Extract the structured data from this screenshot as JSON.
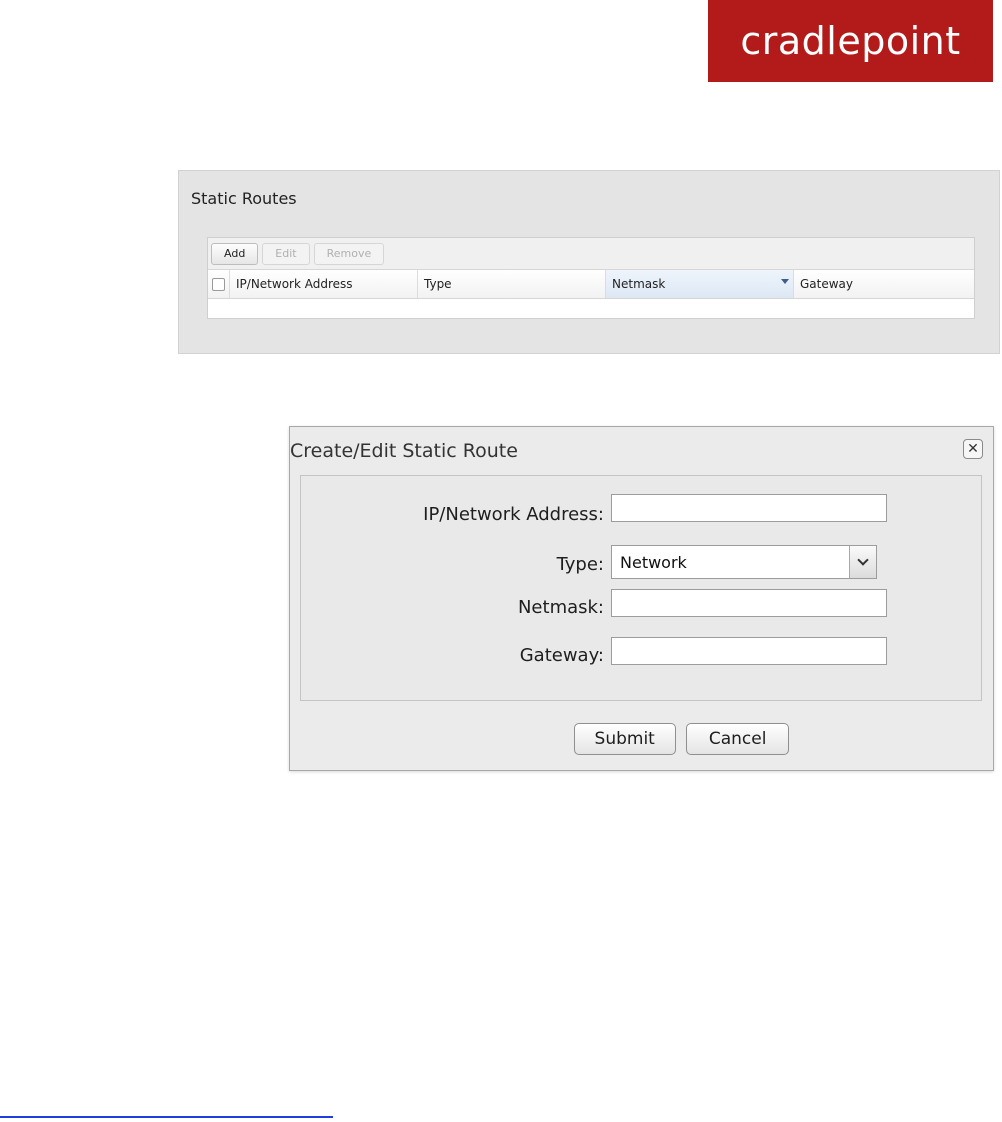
{
  "logo": {
    "text": "cradlepoint",
    "color": "#b31b1b"
  },
  "static_routes": {
    "title": "Static Routes",
    "toolbar": {
      "add": "Add",
      "edit": "Edit",
      "remove": "Remove"
    },
    "columns": [
      "IP/Network Address",
      "Type",
      "Netmask",
      "Gateway"
    ],
    "sorted_column": "Netmask",
    "rows": []
  },
  "dialog": {
    "title": "Create/Edit Static Route",
    "close_icon": "close-icon",
    "fields": {
      "ip": {
        "label": "IP/Network Address:",
        "value": ""
      },
      "type": {
        "label": "Type:",
        "value": "Network"
      },
      "netmask": {
        "label": "Netmask:",
        "value": ""
      },
      "gateway": {
        "label": "Gateway:",
        "value": ""
      }
    },
    "buttons": {
      "submit": "Submit",
      "cancel": "Cancel"
    }
  }
}
